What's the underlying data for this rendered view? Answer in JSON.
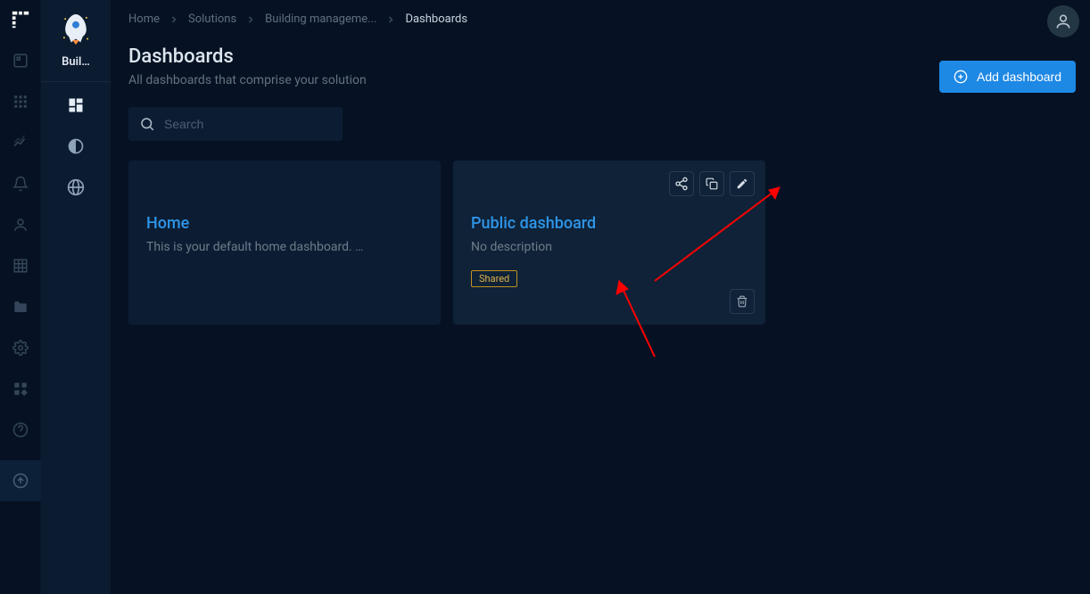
{
  "rail": {
    "items": [
      "dashboard",
      "apps",
      "analytics",
      "alerts",
      "account",
      "enterprise",
      "folder",
      "settings",
      "widgets",
      "help",
      "upload"
    ]
  },
  "sidebar2": {
    "solution_label": "Buil…",
    "items": [
      "dashboards",
      "themes",
      "public"
    ]
  },
  "breadcrumb": {
    "items": [
      "Home",
      "Solutions",
      "Building manageme...",
      "Dashboards"
    ]
  },
  "header": {
    "title": "Dashboards",
    "subtitle": "All dashboards that comprise your solution",
    "add_button": "Add dashboard"
  },
  "search": {
    "placeholder": "Search",
    "value": ""
  },
  "cards": [
    {
      "title": "Home",
      "description": "This is your default home dashboard. …",
      "shared": false,
      "hover": false
    },
    {
      "title": "Public dashboard",
      "description": "No description",
      "shared": true,
      "shared_label": "Shared",
      "hover": true
    }
  ],
  "annotations": {
    "arrow1_target": "share-button",
    "arrow2_target": "shared-badge"
  }
}
